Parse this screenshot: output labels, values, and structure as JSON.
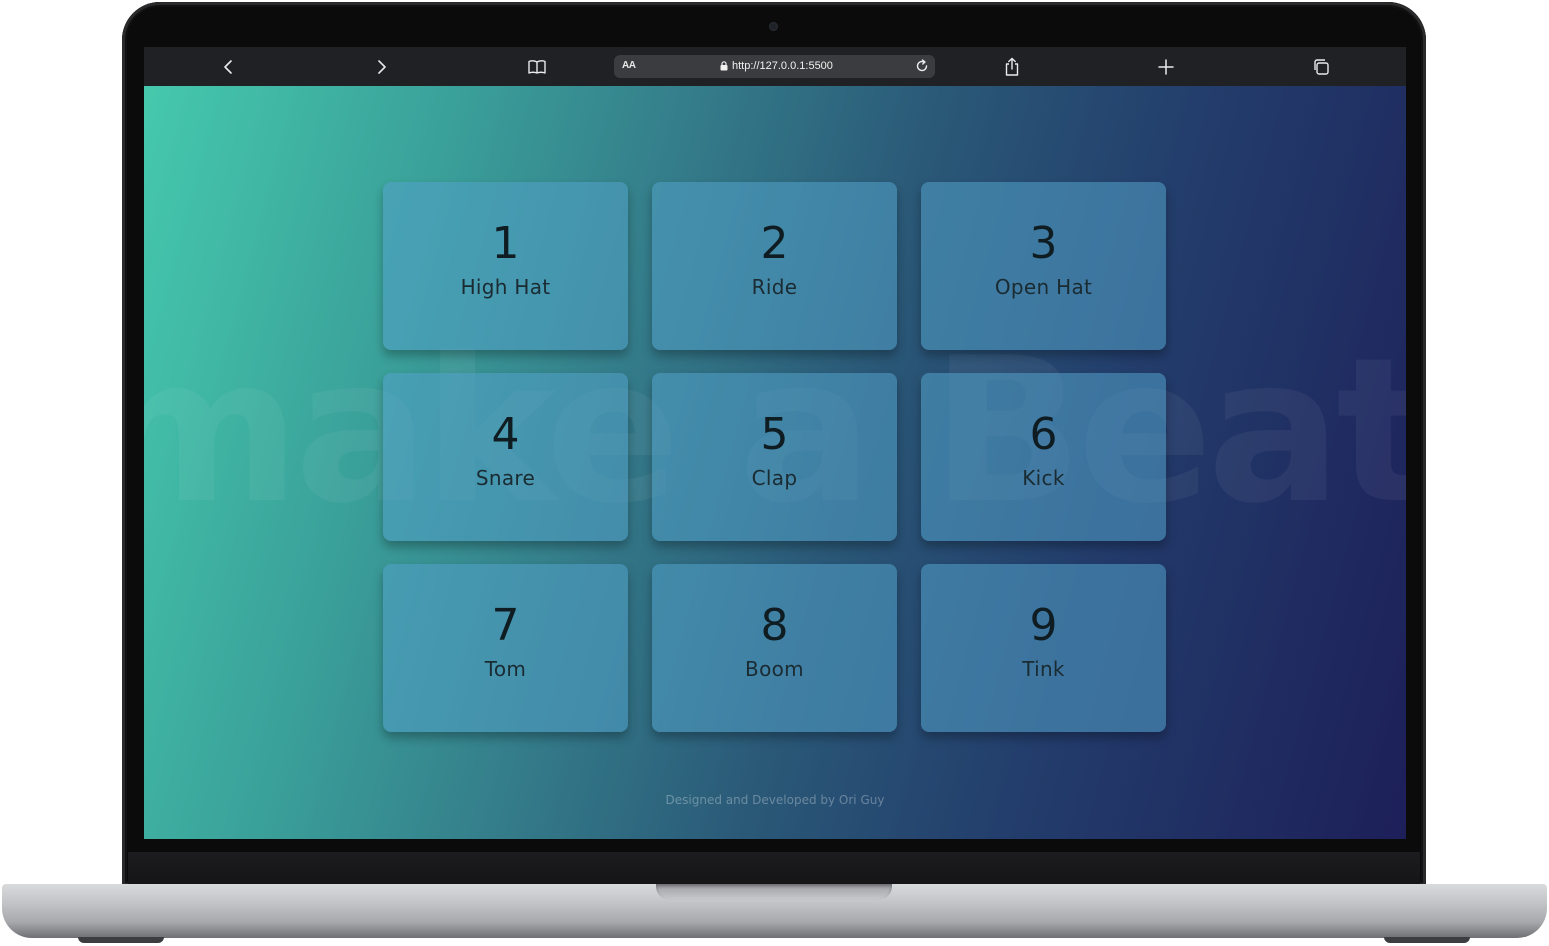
{
  "browser": {
    "reader_label": "AA",
    "url": "http://127.0.0.1:5500"
  },
  "page": {
    "background_title": "make a Beat",
    "pads": [
      {
        "key": "1",
        "sound": "High Hat"
      },
      {
        "key": "2",
        "sound": "Ride"
      },
      {
        "key": "3",
        "sound": "Open Hat"
      },
      {
        "key": "4",
        "sound": "Snare"
      },
      {
        "key": "5",
        "sound": "Clap"
      },
      {
        "key": "6",
        "sound": "Kick"
      },
      {
        "key": "7",
        "sound": "Tom"
      },
      {
        "key": "8",
        "sound": "Boom"
      },
      {
        "key": "9",
        "sound": "Tink"
      }
    ],
    "footer": "Designed and Developed by Ori Guy"
  },
  "colors": {
    "gradient_start": "#45c9ad",
    "gradient_end": "#1d1f59",
    "toolbar": "#202124"
  }
}
